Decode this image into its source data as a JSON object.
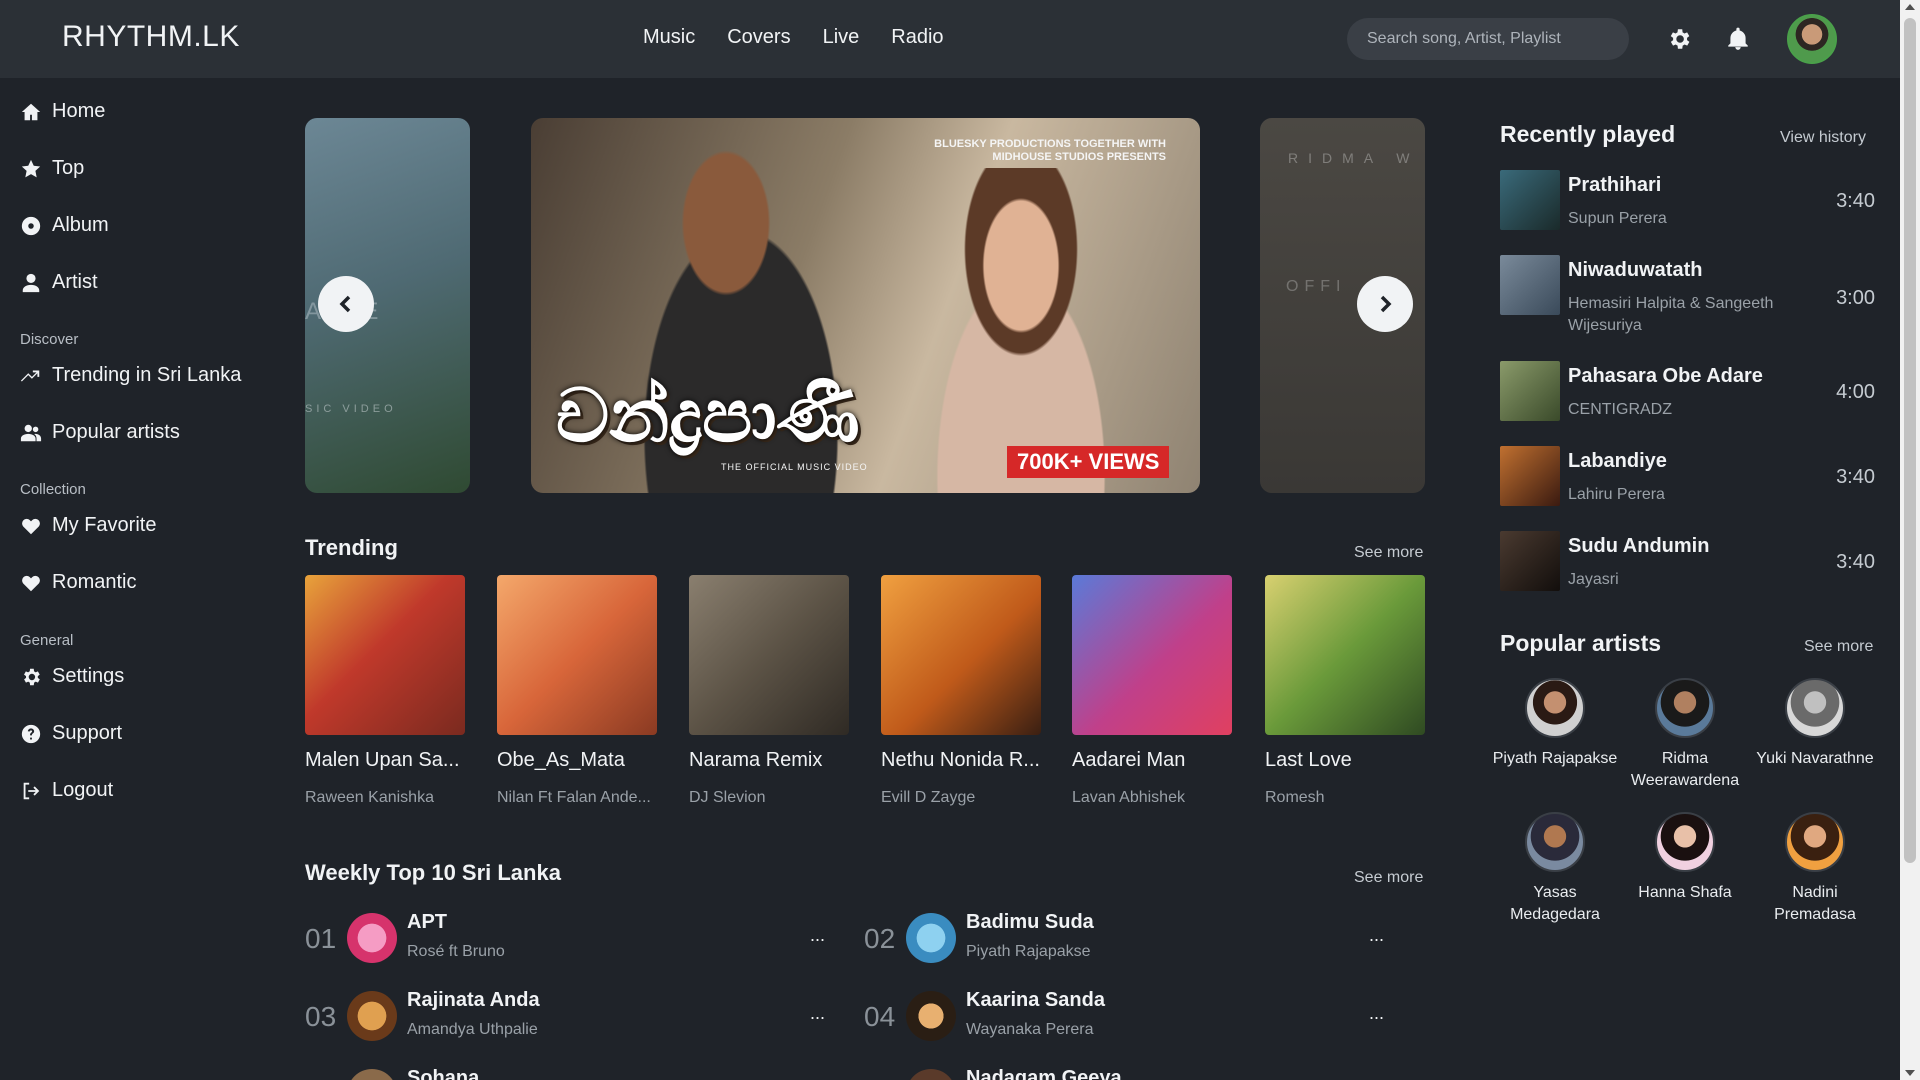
{
  "app": {
    "logo": "RHYTHM.LK"
  },
  "topnav": [
    "Music",
    "Covers",
    "Live",
    "Radio"
  ],
  "search": {
    "placeholder": "Search song, Artist, Playlist"
  },
  "icons": {
    "settings": "gear-icon",
    "notifications": "bell-icon"
  },
  "sidebar": {
    "main": [
      {
        "label": "Home",
        "icon": "home-icon"
      },
      {
        "label": "Top",
        "icon": "star-icon"
      },
      {
        "label": "Album",
        "icon": "disc-icon"
      },
      {
        "label": "Artist",
        "icon": "user-icon"
      }
    ],
    "discover_heading": "Discover",
    "discover": [
      {
        "label": "Trending in Sri Lanka",
        "icon": "trending-icon"
      },
      {
        "label": "Popular artists",
        "icon": "users-icon"
      }
    ],
    "collection_heading": "Collection",
    "collection": [
      {
        "label": "My Favorite",
        "icon": "heart-icon"
      },
      {
        "label": "Romantic",
        "icon": "heart-icon"
      }
    ],
    "general_heading": "General",
    "general": [
      {
        "label": "Settings",
        "icon": "gear-icon"
      },
      {
        "label": "Support",
        "icon": "help-icon"
      },
      {
        "label": "Logout",
        "icon": "logout-icon"
      }
    ]
  },
  "carousel": {
    "credit": "BLUESKY PRODUCTIONS TOGETHER WITH\nMIDHOUSE STUDIOS PRESENTS",
    "title": "චන්ද්‍රපාණී",
    "subtitle": "THE OFFICIAL MUSIC VIDEO",
    "views": "700K+ VIEWS",
    "left_ghost": "ANE",
    "left_ghost_sub": "SIC VIDEO",
    "right_ghost": "RIDMA W",
    "right_ghost_sub": "OFFI"
  },
  "trending": {
    "title": "Trending",
    "see_more": "See more",
    "items": [
      {
        "title": "Malen Upan Sa...",
        "artist": "Raween Kanishka"
      },
      {
        "title": "Obe_As_Mata",
        "artist": "Nilan Ft Falan Ande..."
      },
      {
        "title": "Narama Remix",
        "artist": "DJ Slevion"
      },
      {
        "title": "Nethu Nonida R...",
        "artist": "Evill D Zayge"
      },
      {
        "title": "Aadarei Man",
        "artist": "Lavan Abhishek"
      },
      {
        "title": "Last Love",
        "artist": "Romesh"
      }
    ]
  },
  "weekly": {
    "title": "Weekly Top 10 Sri Lanka",
    "see_more": "See more",
    "items": [
      {
        "rank": "01",
        "title": "APT",
        "artist": "Rosé ft Bruno"
      },
      {
        "rank": "02",
        "title": "Badimu Suda",
        "artist": "Piyath Rajapakse"
      },
      {
        "rank": "03",
        "title": "Rajinata Anda",
        "artist": "Amandya Uthpalie"
      },
      {
        "rank": "04",
        "title": "Kaarina Sanda",
        "artist": "Wayanaka Perera"
      },
      {
        "rank": "",
        "title": "Sohana",
        "artist": ""
      },
      {
        "rank": "",
        "title": "Nadagam Geeya",
        "artist": ""
      }
    ],
    "more_label": "..."
  },
  "recently_played": {
    "title": "Recently played",
    "link": "View history",
    "items": [
      {
        "title": "Prathihari",
        "artist": "Supun Perera",
        "duration": "3:40"
      },
      {
        "title": "Niwaduwatath",
        "artist": "Hemasiri Halpita & Sangeeth Wijesuriya",
        "duration": "3:00"
      },
      {
        "title": "Pahasara Obe Adare",
        "artist": "CENTIGRADZ",
        "duration": "4:00"
      },
      {
        "title": "Labandiye",
        "artist": "Lahiru Perera",
        "duration": "3:40"
      },
      {
        "title": "Sudu Andumin",
        "artist": "Jayasri",
        "duration": "3:40"
      }
    ]
  },
  "popular_artists": {
    "title": "Popular artists",
    "link": "See more",
    "items": [
      {
        "name": "Piyath Rajapakse"
      },
      {
        "name": "Ridma Weerawardena"
      },
      {
        "name": "Yuki Navarathne"
      },
      {
        "name": "Yasas Medagedara"
      },
      {
        "name": "Hanna Shafa"
      },
      {
        "name": "Nadini Premadasa"
      }
    ]
  },
  "colors": {
    "background": "#1f2329",
    "topbar": "#2b3036",
    "accent_badge": "#d62828",
    "muted_text": "#9aa1a8"
  }
}
